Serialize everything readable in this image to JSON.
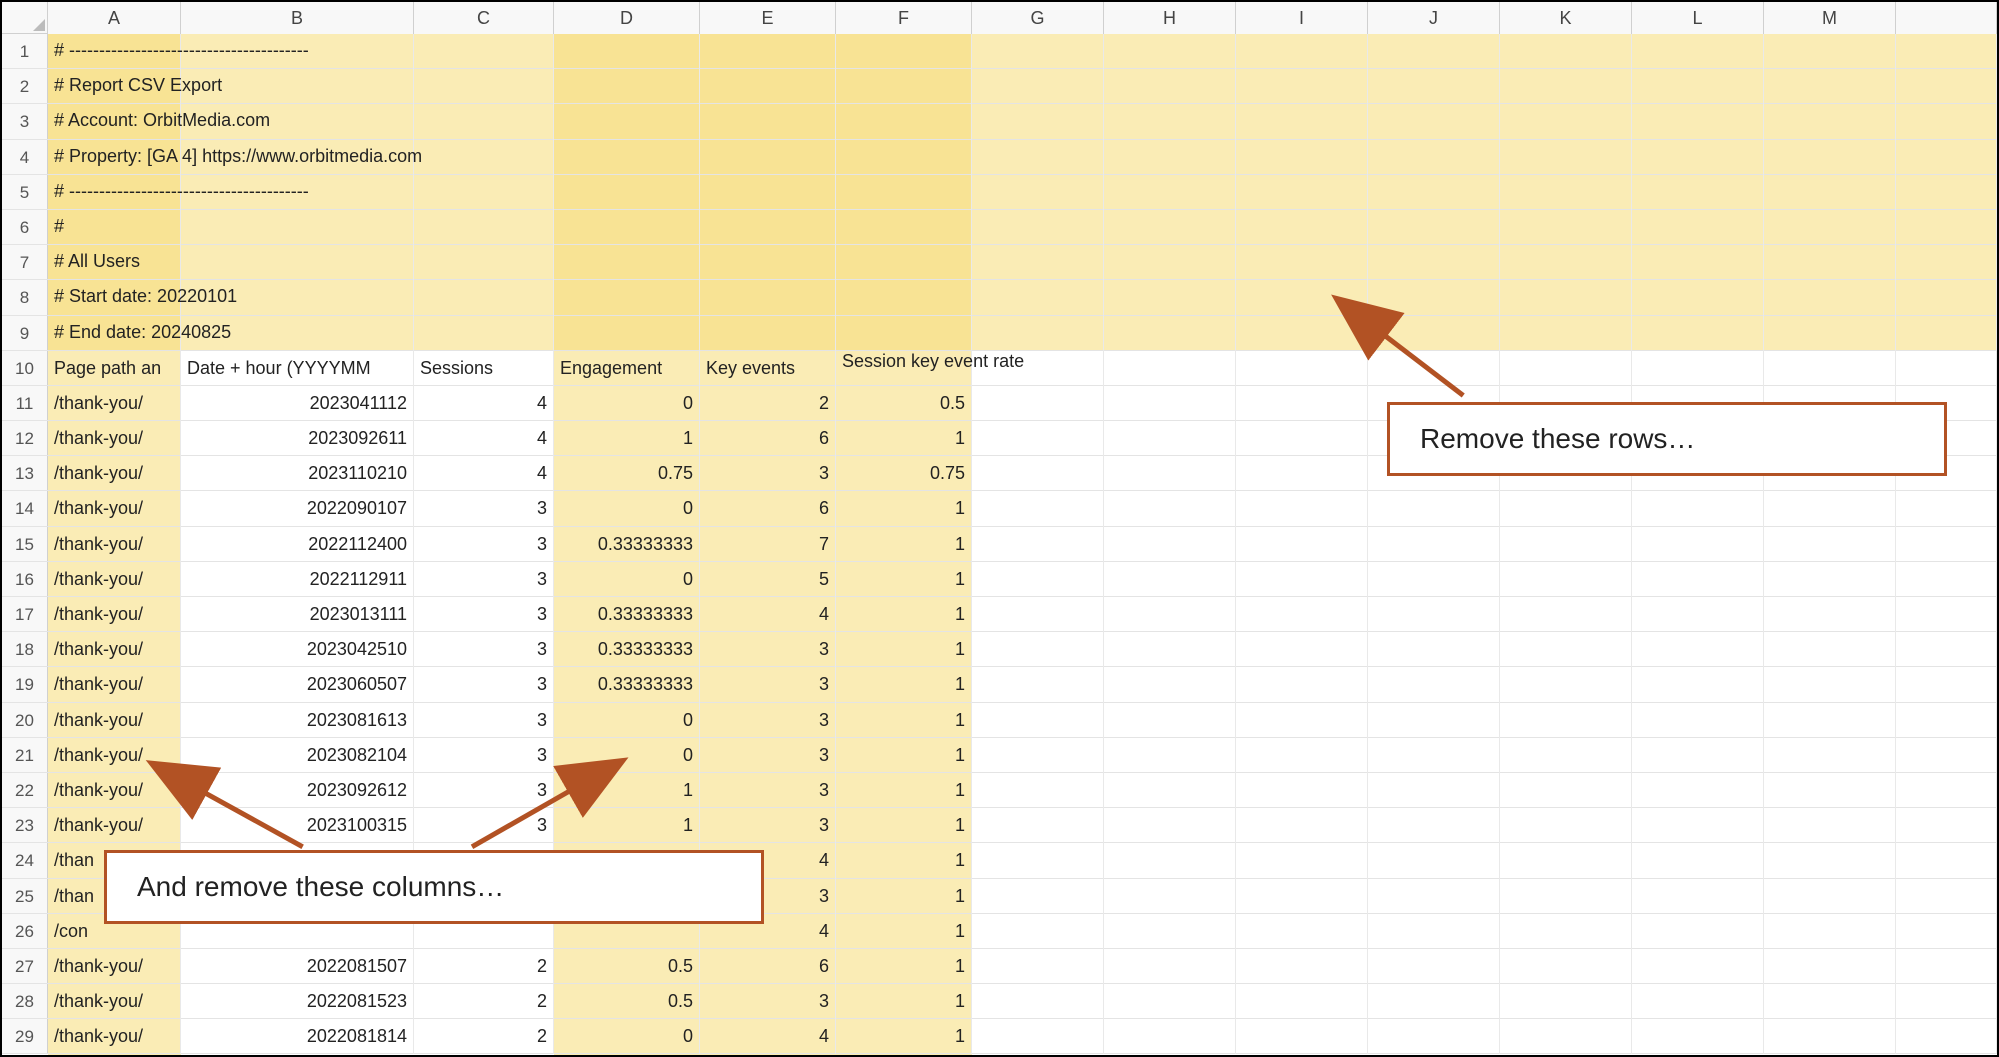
{
  "columns": [
    "A",
    "B",
    "C",
    "D",
    "E",
    "F",
    "G",
    "H",
    "I",
    "J",
    "K",
    "L",
    "M"
  ],
  "meta_rows": [
    "# ----------------------------------------",
    "# Report CSV Export",
    "# Account: OrbitMedia.com",
    "# Property: [GA 4] https://www.orbitmedia.com",
    "# ----------------------------------------",
    "#",
    "# All Users",
    "# Start date: 20220101",
    "# End date: 20240825"
  ],
  "headers": {
    "A": "Page path an",
    "B": "Date + hour (YYYYMM",
    "C": "Sessions",
    "D": "Engagement",
    "E": "Key events",
    "F": "Session key event rate"
  },
  "data_rows": [
    {
      "r": 11,
      "A": "/thank-you/",
      "B": "2023041112",
      "C": "4",
      "D": "0",
      "E": "2",
      "F": "0.5"
    },
    {
      "r": 12,
      "A": "/thank-you/",
      "B": "2023092611",
      "C": "4",
      "D": "1",
      "E": "6",
      "F": "1"
    },
    {
      "r": 13,
      "A": "/thank-you/",
      "B": "2023110210",
      "C": "4",
      "D": "0.75",
      "E": "3",
      "F": "0.75"
    },
    {
      "r": 14,
      "A": "/thank-you/",
      "B": "2022090107",
      "C": "3",
      "D": "0",
      "E": "6",
      "F": "1"
    },
    {
      "r": 15,
      "A": "/thank-you/",
      "B": "2022112400",
      "C": "3",
      "D": "0.33333333",
      "E": "7",
      "F": "1"
    },
    {
      "r": 16,
      "A": "/thank-you/",
      "B": "2022112911",
      "C": "3",
      "D": "0",
      "E": "5",
      "F": "1"
    },
    {
      "r": 17,
      "A": "/thank-you/",
      "B": "2023013111",
      "C": "3",
      "D": "0.33333333",
      "E": "4",
      "F": "1"
    },
    {
      "r": 18,
      "A": "/thank-you/",
      "B": "2023042510",
      "C": "3",
      "D": "0.33333333",
      "E": "3",
      "F": "1"
    },
    {
      "r": 19,
      "A": "/thank-you/",
      "B": "2023060507",
      "C": "3",
      "D": "0.33333333",
      "E": "3",
      "F": "1"
    },
    {
      "r": 20,
      "A": "/thank-you/",
      "B": "2023081613",
      "C": "3",
      "D": "0",
      "E": "3",
      "F": "1"
    },
    {
      "r": 21,
      "A": "/thank-you/",
      "B": "2023082104",
      "C": "3",
      "D": "0",
      "E": "3",
      "F": "1"
    },
    {
      "r": 22,
      "A": "/thank-you/",
      "B": "2023092612",
      "C": "3",
      "D": "1",
      "E": "3",
      "F": "1"
    },
    {
      "r": 23,
      "A": "/thank-you/",
      "B": "2023100315",
      "C": "3",
      "D": "1",
      "E": "3",
      "F": "1"
    },
    {
      "r": 24,
      "A": "/than",
      "B": "",
      "C": "",
      "D": "",
      "E": "4",
      "F": "1"
    },
    {
      "r": 25,
      "A": "/than",
      "B": "",
      "C": "",
      "D": "",
      "E": "3",
      "F": "1"
    },
    {
      "r": 26,
      "A": "/con",
      "B": "",
      "C": "",
      "D": "",
      "E": "4",
      "F": "1"
    },
    {
      "r": 27,
      "A": "/thank-you/",
      "B": "2022081507",
      "C": "2",
      "D": "0.5",
      "E": "6",
      "F": "1"
    },
    {
      "r": 28,
      "A": "/thank-you/",
      "B": "2022081523",
      "C": "2",
      "D": "0.5",
      "E": "3",
      "F": "1"
    },
    {
      "r": 29,
      "A": "/thank-you/",
      "B": "2022081814",
      "C": "2",
      "D": "0",
      "E": "4",
      "F": "1"
    }
  ],
  "annotations": {
    "remove_rows": "Remove these rows…",
    "remove_cols": "And remove these columns…"
  },
  "colors": {
    "highlight": "#f3e0a0",
    "callout_border": "#b25224"
  }
}
